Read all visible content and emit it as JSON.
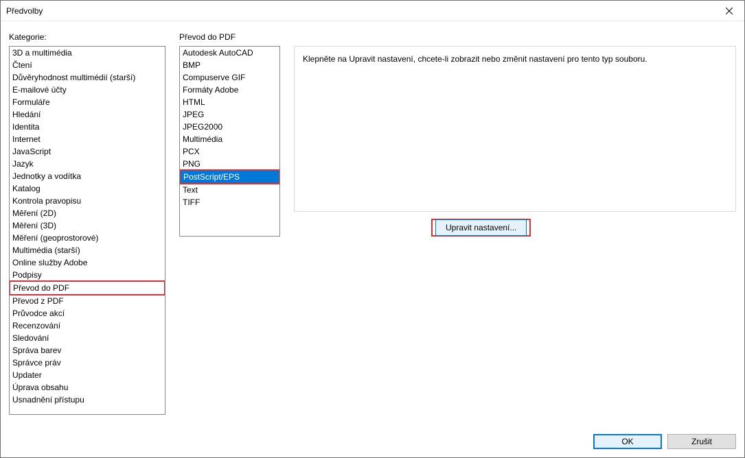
{
  "window": {
    "title": "Předvolby"
  },
  "categories": {
    "label": "Kategorie:",
    "items": [
      "3D a multimédia",
      "Čtení",
      "Důvěryhodnost multimédií (starší)",
      "E-mailové účty",
      "Formuláře",
      "Hledání",
      "Identita",
      "Internet",
      "JavaScript",
      "Jazyk",
      "Jednotky a vodítka",
      "Katalog",
      "Kontrola pravopisu",
      "Měření (2D)",
      "Měření (3D)",
      "Měření (geoprostorové)",
      "Multimédia (starší)",
      "Online služby Adobe",
      "Podpisy",
      "Převod do PDF",
      "Převod z PDF",
      "Průvodce akcí",
      "Recenzování",
      "Sledování",
      "Správa barev",
      "Správce práv",
      "Updater",
      "Úprava obsahu",
      "Usnadnění přístupu"
    ],
    "highlighted": "Převod do PDF"
  },
  "conversion": {
    "label": "Převod do PDF",
    "items": [
      "Autodesk AutoCAD",
      "BMP",
      "Compuserve GIF",
      "Formáty Adobe",
      "HTML",
      "JPEG",
      "JPEG2000",
      "Multimédia",
      "PCX",
      "PNG",
      "PostScript/EPS",
      "Text",
      "TIFF"
    ],
    "selected": "PostScript/EPS"
  },
  "description": {
    "text": "Klepněte na Upravit nastavení, chcete-li zobrazit nebo změnit nastavení pro tento typ souboru."
  },
  "buttons": {
    "edit_settings": "Upravit nastavení...",
    "ok": "OK",
    "cancel": "Zrušit"
  }
}
